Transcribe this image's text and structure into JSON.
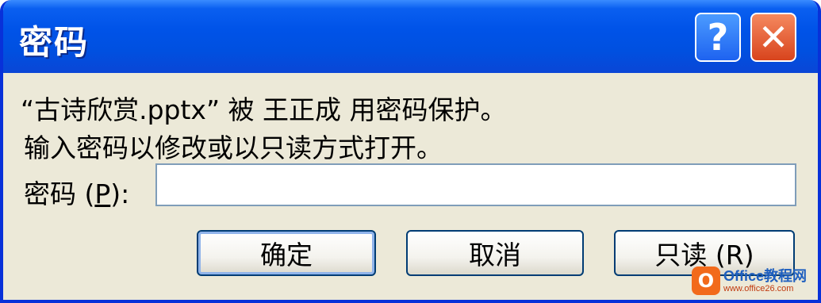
{
  "window": {
    "title": "密码",
    "help_glyph": "?",
    "close_glyph": "✕"
  },
  "message": {
    "line1": "“古诗欣赏.pptx” 被 王正成 用密码保护。",
    "line2": "输入密码以修改或以只读方式打开。"
  },
  "password": {
    "label_prefix": "密码 (",
    "label_key": "P",
    "label_suffix": "):",
    "value": "",
    "placeholder": ""
  },
  "buttons": {
    "ok": "确定",
    "cancel": "取消",
    "readonly": "只读 (R)"
  },
  "watermark": {
    "logo": "O",
    "title": "Office教程网",
    "url": "www.office26.com"
  },
  "colors": {
    "titlebar": "#0053e8",
    "dialog_bg": "#ece9d8",
    "close_button": "#d8441d",
    "help_button": "#1e63f0",
    "input_border": "#7f9db9"
  }
}
